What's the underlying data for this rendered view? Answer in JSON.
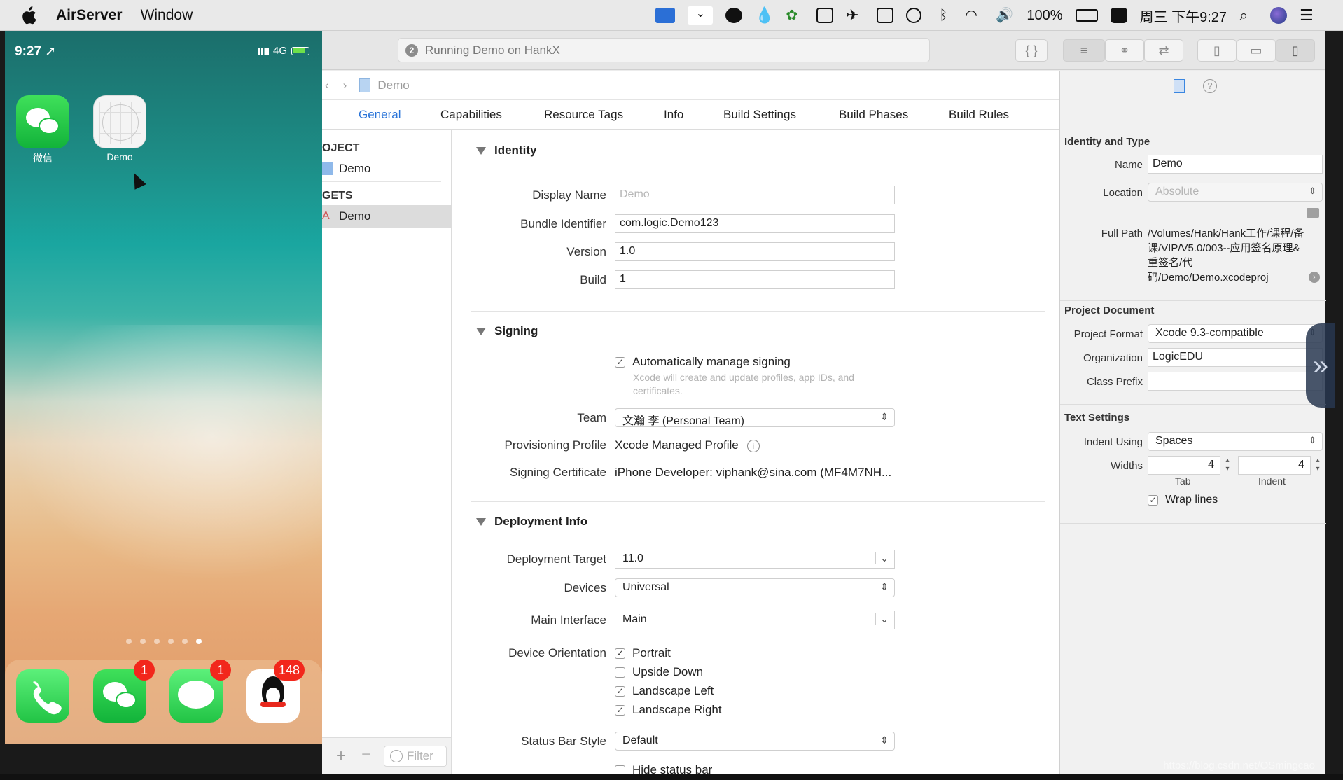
{
  "menubar": {
    "app_name": "AirServer",
    "menus": [
      "Window"
    ],
    "battery": "100%",
    "clock": "周三 下午9:27"
  },
  "phone": {
    "time": "9:27",
    "network": "4G",
    "apps": [
      {
        "label": "微信",
        "icon": "wechat-icon"
      },
      {
        "label": "Demo",
        "icon": "demo-app-icon"
      }
    ],
    "dock": [
      {
        "icon": "phone-icon",
        "badge": ""
      },
      {
        "icon": "wechat-icon",
        "badge": "1"
      },
      {
        "icon": "messages-icon",
        "badge": "1"
      },
      {
        "icon": "qq-icon",
        "badge": "148"
      }
    ],
    "page_count": 6,
    "current_page": 6
  },
  "toolbar": {
    "activity_number": "2",
    "activity_text": "Running Demo on HankX"
  },
  "jumpbar": {
    "file": "Demo"
  },
  "tabs": [
    "General",
    "Capabilities",
    "Resource Tags",
    "Info",
    "Build Settings",
    "Build Phases",
    "Build Rules"
  ],
  "outline": {
    "project_header": "OJECT",
    "project_item": "Demo",
    "targets_header": "GETS",
    "target_item": "Demo"
  },
  "identity": {
    "title": "Identity",
    "display_name_label": "Display Name",
    "display_name_placeholder": "Demo",
    "bundle_label": "Bundle Identifier",
    "bundle_value": "com.logic.Demo123",
    "version_label": "Version",
    "version_value": "1.0",
    "build_label": "Build",
    "build_value": "1"
  },
  "signing": {
    "title": "Signing",
    "auto_label": "Automatically manage signing",
    "auto_hint": "Xcode will create and update profiles, app IDs, and certificates.",
    "team_label": "Team",
    "team_value": "文瀚 李 (Personal Team)",
    "profile_label": "Provisioning Profile",
    "profile_value": "Xcode Managed Profile",
    "cert_label": "Signing Certificate",
    "cert_value": "iPhone Developer: viphank@sina.com (MF4M7NH..."
  },
  "deployment": {
    "title": "Deployment Info",
    "target_label": "Deployment Target",
    "target_value": "11.0",
    "devices_label": "Devices",
    "devices_value": "Universal",
    "interface_label": "Main Interface",
    "interface_value": "Main",
    "orientation_label": "Device Orientation",
    "orientations": [
      {
        "label": "Portrait",
        "checked": true
      },
      {
        "label": "Upside Down",
        "checked": false
      },
      {
        "label": "Landscape Left",
        "checked": true
      },
      {
        "label": "Landscape Right",
        "checked": true
      }
    ],
    "status_style_label": "Status Bar Style",
    "status_style_value": "Default",
    "hide_status_label": "Hide status bar"
  },
  "filter": {
    "placeholder": "Filter"
  },
  "inspector": {
    "identity_title": "Identity and Type",
    "name_label": "Name",
    "name_value": "Demo",
    "location_label": "Location",
    "location_value": "Absolute",
    "fullpath_label": "Full Path",
    "fullpath_value": "/Volumes/Hank/Hank工作/课程/备课/VIP/V5.0/003--应用签名原理&重签名/代码/Demo/Demo.xcodeproj",
    "projdoc_title": "Project Document",
    "format_label": "Project Format",
    "format_value": "Xcode 9.3-compatible",
    "org_label": "Organization",
    "org_value": "LogicEDU",
    "prefix_label": "Class Prefix",
    "prefix_value": "",
    "text_title": "Text Settings",
    "indent_label": "Indent Using",
    "indent_value": "Spaces",
    "widths_label": "Widths",
    "tab_width": "4",
    "indent_width": "4",
    "tab_label": "Tab",
    "indent_sub_label": "Indent",
    "wrap_label": "Wrap lines"
  },
  "watermark": "https://blog.csdn.net/OSmingcao"
}
